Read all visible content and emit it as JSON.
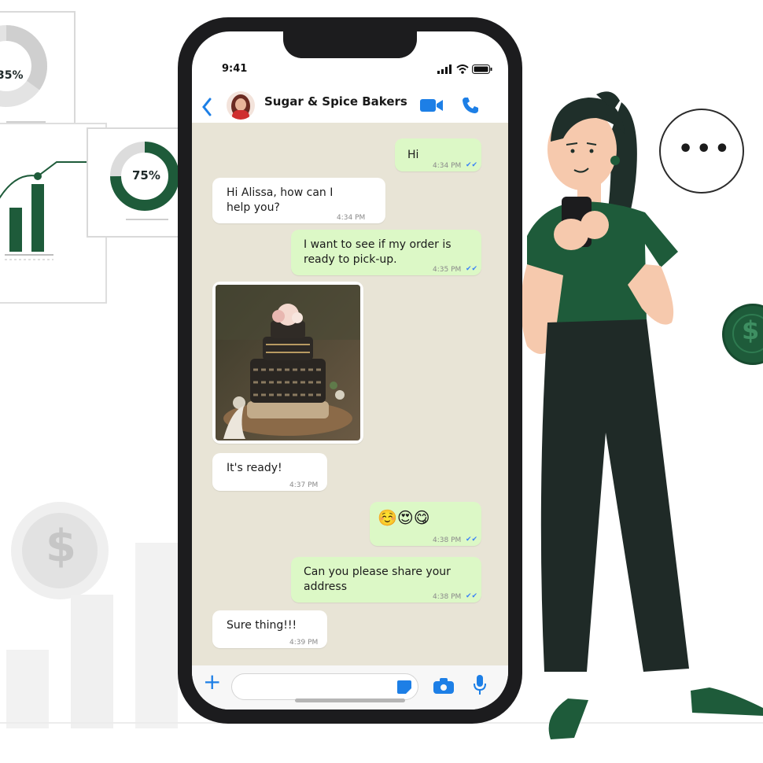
{
  "colors": {
    "brand_green": "#1e5b3a",
    "ios_blue": "#1d7fe6",
    "incoming_bubble": "#ffffff",
    "outgoing_bubble": "#dcf8c6",
    "chat_background": "#e8e4d6"
  },
  "decor": {
    "donut_small_label": "35%",
    "donut_large_label": "75%",
    "donut_small_value": 0.35,
    "donut_large_value": 0.75,
    "coin_icon": "dollar-coin-icon",
    "typing_icon": "ellipsis-speech-icon"
  },
  "status_bar": {
    "time": "9:41",
    "icons": [
      "signal-icon",
      "wifi-icon",
      "battery-icon"
    ]
  },
  "header": {
    "back_icon": "chevron-left-icon",
    "contact_name": "Sugar & Spice Bakers",
    "video_icon": "video-camera-icon",
    "call_icon": "phone-icon"
  },
  "messages": [
    {
      "direction": "out",
      "text": "Hi",
      "time": "4:34 PM",
      "read": true
    },
    {
      "direction": "in",
      "text": "Hi Alissa, how can I help you?",
      "time": "4:34 PM"
    },
    {
      "direction": "out",
      "text": "I want to see if my order is ready to pick-up.",
      "time": "4:35 PM",
      "read": true
    },
    {
      "direction": "in",
      "type": "image",
      "image_description": "cake-photo"
    },
    {
      "direction": "in",
      "text": "It's ready!",
      "time": "4:37 PM"
    },
    {
      "direction": "out",
      "text": "☺️😍😋",
      "time": "4:38 PM",
      "read": true
    },
    {
      "direction": "out",
      "text": "Can you please share your address",
      "time": "4:38 PM",
      "read": true
    },
    {
      "direction": "in",
      "text": "Sure thing!!!",
      "time": "4:39 PM"
    }
  ],
  "composer": {
    "add_icon": "plus-icon",
    "sticker_icon": "sticker-icon",
    "camera_icon": "camera-icon",
    "mic_icon": "microphone-icon"
  }
}
